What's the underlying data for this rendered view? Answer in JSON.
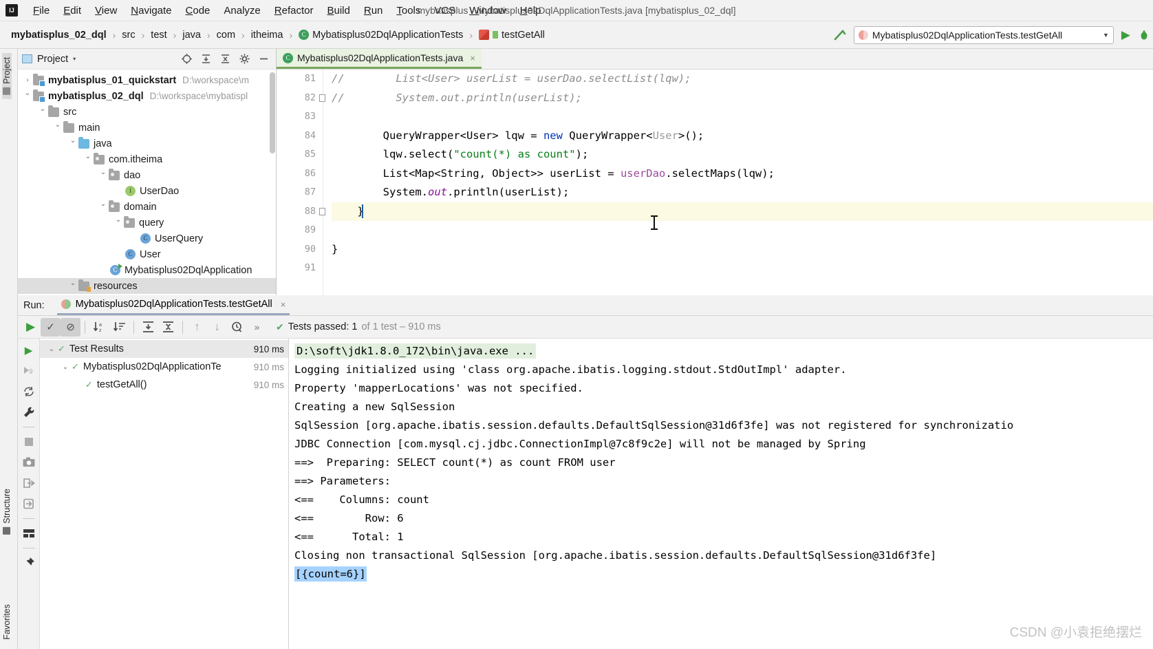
{
  "window": {
    "title": "mybatisplus - Mybatisplus02DqlApplicationTests.java [mybatisplus_02_dql]"
  },
  "menubar": {
    "items": [
      {
        "label": "File"
      },
      {
        "label": "Edit"
      },
      {
        "label": "View"
      },
      {
        "label": "Navigate"
      },
      {
        "label": "Code"
      },
      {
        "label": "Analyze"
      },
      {
        "label": "Refactor"
      },
      {
        "label": "Build"
      },
      {
        "label": "Run"
      },
      {
        "label": "Tools"
      },
      {
        "label": "VCS"
      },
      {
        "label": "Window"
      },
      {
        "label": "Help"
      }
    ]
  },
  "breadcrumb": {
    "items": [
      {
        "label": "mybatisplus_02_dql",
        "icon": "none",
        "bold": true
      },
      {
        "label": "src",
        "icon": "none",
        "bold": false
      },
      {
        "label": "test",
        "icon": "none",
        "bold": false
      },
      {
        "label": "java",
        "icon": "none",
        "bold": false
      },
      {
        "label": "com",
        "icon": "none",
        "bold": false
      },
      {
        "label": "itheima",
        "icon": "none",
        "bold": false
      },
      {
        "label": "Mybatisplus02DqlApplicationTests",
        "icon": "test-class-icon",
        "bold": false
      },
      {
        "label": "testGetAll",
        "icon": "test-method-icon",
        "bold": false
      }
    ]
  },
  "run_config": {
    "name": "Mybatisplus02DqlApplicationTests.testGetAll",
    "caret": "▼",
    "run_icon": "run-icon",
    "debug_icon": "debug-icon",
    "build_icon": "build-hammer-icon"
  },
  "left_strip": {
    "tabs": [
      {
        "label": "Project",
        "icon": "project-icon",
        "active": true
      },
      {
        "label": "Structure",
        "icon": "structure-icon",
        "active": false
      },
      {
        "label": "Favorites",
        "icon": "favorites-icon",
        "active": false
      }
    ]
  },
  "project_panel": {
    "title": "Project",
    "caret": "▾",
    "tools": [
      "locate-icon",
      "expand-all-icon",
      "collapse-all-icon",
      "settings-gear-icon",
      "hide-icon"
    ],
    "tree": [
      {
        "depth": 0,
        "chev": "closed",
        "icon": "module-folder-icon",
        "label": "mybatisplus_01_quickstart",
        "bold": true,
        "path": "D:\\workspace\\m"
      },
      {
        "depth": 0,
        "chev": "open",
        "icon": "module-folder-icon",
        "label": "mybatisplus_02_dql",
        "bold": true,
        "path": "D:\\workspace\\mybatispl"
      },
      {
        "depth": 1,
        "chev": "open",
        "icon": "folder-icon",
        "label": "src",
        "bold": false,
        "path": ""
      },
      {
        "depth": 2,
        "chev": "open",
        "icon": "folder-icon",
        "label": "main",
        "bold": false,
        "path": ""
      },
      {
        "depth": 3,
        "chev": "open",
        "icon": "source-folder-icon",
        "label": "java",
        "bold": false,
        "path": ""
      },
      {
        "depth": 4,
        "chev": "open",
        "icon": "package-icon",
        "label": "com.itheima",
        "bold": false,
        "path": ""
      },
      {
        "depth": 5,
        "chev": "open",
        "icon": "package-icon",
        "label": "dao",
        "bold": false,
        "path": ""
      },
      {
        "depth": 6,
        "chev": "none",
        "icon": "interface-icon",
        "label": "UserDao",
        "bold": false,
        "path": ""
      },
      {
        "depth": 5,
        "chev": "open",
        "icon": "package-icon",
        "label": "domain",
        "bold": false,
        "path": ""
      },
      {
        "depth": 6,
        "chev": "open",
        "icon": "package-icon",
        "label": "query",
        "bold": false,
        "path": ""
      },
      {
        "depth": 7,
        "chev": "none",
        "icon": "class-icon",
        "label": "UserQuery",
        "bold": false,
        "path": ""
      },
      {
        "depth": 6,
        "chev": "none",
        "icon": "class-icon",
        "label": "User",
        "bold": false,
        "path": ""
      },
      {
        "depth": 5,
        "chev": "none",
        "icon": "spring-app-icon",
        "label": "Mybatisplus02DqlApplication",
        "bold": false,
        "path": ""
      },
      {
        "depth": 3,
        "chev": "open",
        "icon": "resources-folder-icon",
        "label": "resources",
        "bold": false,
        "path": ""
      }
    ]
  },
  "editor": {
    "tab": {
      "label": "Mybatisplus02DqlApplicationTests.java",
      "icon": "test-class-icon",
      "close": "×"
    },
    "lines": [
      {
        "num": "81",
        "fold": false,
        "highlight": false,
        "tokens": [
          {
            "t": "//        ",
            "c": "cmt"
          },
          {
            "t": "List<User> userList = userDao.selectList(lqw);",
            "c": "cmt"
          }
        ]
      },
      {
        "num": "82",
        "fold": true,
        "highlight": false,
        "tokens": [
          {
            "t": "//        ",
            "c": "cmt"
          },
          {
            "t": "System.out.println(userList);",
            "c": "cmt"
          }
        ]
      },
      {
        "num": "83",
        "fold": false,
        "highlight": false,
        "tokens": []
      },
      {
        "num": "84",
        "fold": false,
        "highlight": false,
        "tokens": [
          {
            "t": "        QueryWrapper<User> lqw = ",
            "c": "typ"
          },
          {
            "t": "new",
            "c": "kw"
          },
          {
            "t": " QueryWrapper<",
            "c": "typ"
          },
          {
            "t": "User",
            "c": "gry"
          },
          {
            "t": ">();",
            "c": "typ"
          }
        ]
      },
      {
        "num": "85",
        "fold": false,
        "highlight": false,
        "tokens": [
          {
            "t": "        lqw.select(",
            "c": "typ"
          },
          {
            "t": "\"count(*) as count\"",
            "c": "str"
          },
          {
            "t": ");",
            "c": "typ"
          }
        ]
      },
      {
        "num": "86",
        "fold": false,
        "highlight": false,
        "tokens": [
          {
            "t": "        List<Map<String, Object>> userList = ",
            "c": "typ"
          },
          {
            "t": "userDao",
            "c": "mth"
          },
          {
            "t": ".selectMaps(lqw);",
            "c": "typ"
          }
        ]
      },
      {
        "num": "87",
        "fold": false,
        "highlight": false,
        "tokens": [
          {
            "t": "        System.",
            "c": "typ"
          },
          {
            "t": "out",
            "c": "fld2"
          },
          {
            "t": ".println(userList);",
            "c": "typ"
          }
        ]
      },
      {
        "num": "88",
        "fold": true,
        "highlight": true,
        "tokens": [
          {
            "t": "    }",
            "c": "typ"
          }
        ]
      },
      {
        "num": "89",
        "fold": false,
        "highlight": false,
        "tokens": []
      },
      {
        "num": "90",
        "fold": false,
        "highlight": false,
        "tokens": [
          {
            "t": "}",
            "c": "typ"
          }
        ]
      },
      {
        "num": "91",
        "fold": false,
        "highlight": false,
        "tokens": []
      }
    ]
  },
  "run_panel": {
    "label": "Run:",
    "tab": {
      "label": "Mybatisplus02DqlApplicationTests.testGetAll",
      "close": "×"
    },
    "toolbar": [
      {
        "name": "rerun-button",
        "glyph": "▶",
        "pressed": false
      },
      {
        "name": "show-passed-toggle",
        "glyph": "✓",
        "pressed": true
      },
      {
        "name": "show-ignored-toggle",
        "glyph": "⊘",
        "pressed": true
      },
      {
        "name": "sort-alphabetically-button",
        "glyph": "↓a̲z",
        "pressed": false
      },
      {
        "name": "sort-by-duration-button",
        "glyph": "↓≡",
        "pressed": false
      },
      {
        "name": "expand-all-button",
        "glyph": "↧",
        "pressed": false
      },
      {
        "name": "collapse-all-button",
        "glyph": "↥",
        "pressed": false
      },
      {
        "name": "previous-failed-button",
        "glyph": "↑",
        "pressed": false
      },
      {
        "name": "next-failed-button",
        "glyph": "↓",
        "pressed": false
      },
      {
        "name": "test-history-button",
        "glyph": "◴",
        "pressed": false
      },
      {
        "name": "more-options-button",
        "glyph": "»",
        "pressed": false
      }
    ],
    "status": {
      "check": "✔",
      "main": "Tests passed: 1",
      "dim": " of 1 test – 910 ms"
    },
    "side_icons": [
      "run-icon",
      "rerun-failed-icon",
      "rerun-automatically-icon",
      "settings-wrench-icon",
      "stop-icon",
      "screenshot-icon",
      "export-icon",
      "import-icon",
      "layout-icon",
      "pin-tab-icon"
    ],
    "test_tree": [
      {
        "depth": 0,
        "chev": "open",
        "label": "Test Results",
        "time": "910 ms",
        "dim": false,
        "selected": true
      },
      {
        "depth": 1,
        "chev": "open",
        "label": "Mybatisplus02DqlApplicationTe",
        "time": "910 ms",
        "dim": true,
        "selected": false
      },
      {
        "depth": 2,
        "chev": "none",
        "label": "testGetAll()",
        "time": "910 ms",
        "dim": true,
        "selected": false
      }
    ],
    "console": [
      {
        "segments": [
          {
            "t": "D:\\soft\\jdk1.8.0_172\\bin\\java.exe ...",
            "hl": "cmd"
          }
        ]
      },
      {
        "segments": [
          {
            "t": "Logging initialized using 'class org.apache.ibatis.logging.stdout.StdOutImpl' adapter.",
            "hl": "none"
          }
        ]
      },
      {
        "segments": [
          {
            "t": "Property 'mapperLocations' was not specified.",
            "hl": "none"
          }
        ]
      },
      {
        "segments": [
          {
            "t": "Creating a new SqlSession",
            "hl": "none"
          }
        ]
      },
      {
        "segments": [
          {
            "t": "SqlSession [org.apache.ibatis.session.defaults.DefaultSqlSession@31d6f3fe] was not registered for synchronizatio",
            "hl": "none"
          }
        ]
      },
      {
        "segments": [
          {
            "t": "JDBC Connection [com.mysql.cj.jdbc.ConnectionImpl@7c8f9c2e] will not be managed by Spring",
            "hl": "none"
          }
        ]
      },
      {
        "segments": [
          {
            "t": "==>  Preparing: SELECT count(*) as count FROM user",
            "hl": "none"
          }
        ]
      },
      {
        "segments": [
          {
            "t": "==> Parameters:",
            "hl": "none"
          }
        ]
      },
      {
        "segments": [
          {
            "t": "<==    Columns: count",
            "hl": "none"
          }
        ]
      },
      {
        "segments": [
          {
            "t": "<==        Row: 6",
            "hl": "none"
          }
        ]
      },
      {
        "segments": [
          {
            "t": "<==      Total: 1",
            "hl": "none"
          }
        ]
      },
      {
        "segments": [
          {
            "t": "Closing non transactional SqlSession [org.apache.ibatis.session.defaults.DefaultSqlSession@31d6f3fe]",
            "hl": "none"
          }
        ]
      },
      {
        "segments": [
          {
            "t": "[{count=6}]",
            "hl": "blue"
          }
        ]
      }
    ]
  },
  "watermark": "CSDN @小袁拒绝摆烂",
  "colors": {
    "accent_green": "#59a869",
    "keyword_blue": "#0033b3",
    "string_green": "#067d17",
    "comment_gray": "#8c8c8c",
    "field_purple": "#871094",
    "highlight_blue": "#a6d2ff",
    "command_highlight": "#e1eedd"
  }
}
